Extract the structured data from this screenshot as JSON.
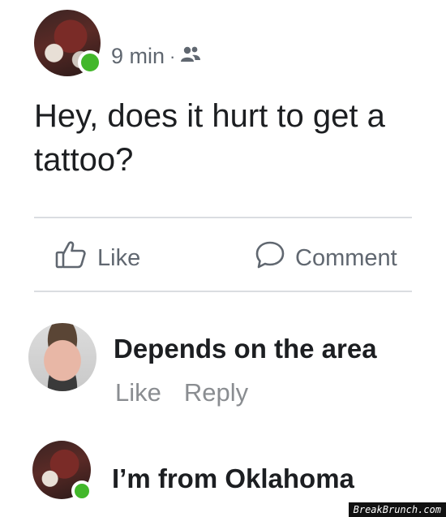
{
  "post": {
    "time": "9 min",
    "separator": "·",
    "audience_icon": "friends-icon",
    "text": "Hey, does it hurt to get a tattoo?"
  },
  "actions": {
    "like_label": "Like",
    "comment_label": "Comment"
  },
  "comments": [
    {
      "text": "Depends on the area",
      "like_label": "Like",
      "reply_label": "Reply"
    },
    {
      "text": "I’m from Oklahoma"
    }
  ],
  "colors": {
    "online": "#42b72a",
    "muted": "#606770",
    "text": "#1c1e21",
    "divider": "#dadde1"
  },
  "watermark": "BreakBrunch.com"
}
